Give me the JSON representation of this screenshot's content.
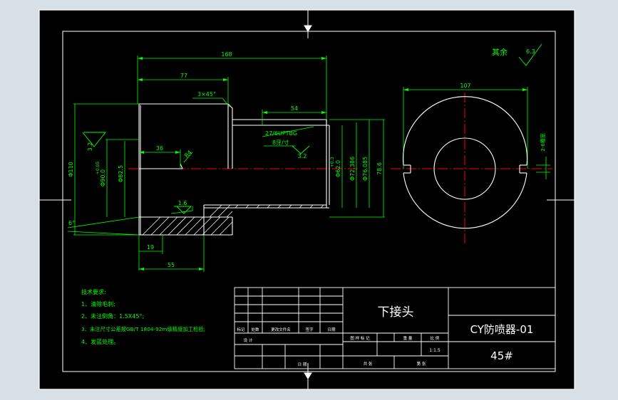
{
  "colors": {
    "background": "#d6e0e6",
    "sheet": "#000000",
    "outline": "#ffffff",
    "dimension": "#00ff00",
    "centerline": "#ff0000"
  },
  "dimensions": {
    "total_length": "168",
    "left_bore_depth": "77",
    "chamfer": "3×45°",
    "thread_length": "54",
    "thread_spec": "27/6UPTBG",
    "thread_spec_2": "8牙/寸",
    "roughness_bore": "3.2",
    "roughness_thread": "3.2",
    "length_36": "36",
    "radius": "R4",
    "dia_110": "Φ110",
    "dia_90": "Φ90.0",
    "dia_90_tol": "+0.05",
    "dia_82": "Φ82.5",
    "dia_62": "Φ62.0",
    "dia_62_tol": "+0.3",
    "dia_72": "Φ72.386",
    "dia_76": "Φ76.085",
    "dia_78": "78.6",
    "roughness_1_6": "1.6",
    "angle_6": "6°",
    "length_19": "19",
    "length_55": "55",
    "circle_dia": "107",
    "slot_width": "2-6槽宽",
    "remainder": "其余",
    "remainder_roughness": "6.3"
  },
  "tech_notes": {
    "title": "技术要求:",
    "lines": [
      "1、清除毛刺;",
      "2、未注倒角：1.5X45°;",
      "3、未注尺寸公差按GB/T 1804-92m级精度加工检验;",
      "4、发蓝处理。"
    ]
  },
  "title_block": {
    "part_name": "下接头",
    "drawing_no": "CY防喷器-01",
    "material": "45#",
    "scale": "1:1.5",
    "rev_headers": [
      "标记",
      "处数",
      "更改文件名",
      "签字",
      "日期"
    ],
    "roles": {
      "design": "设 计",
      "date": "日 期"
    },
    "stage_headers": [
      "图 样 标 记",
      "重 量",
      "比 例"
    ],
    "sheet_headers": [
      "共 张",
      "第 张"
    ]
  }
}
